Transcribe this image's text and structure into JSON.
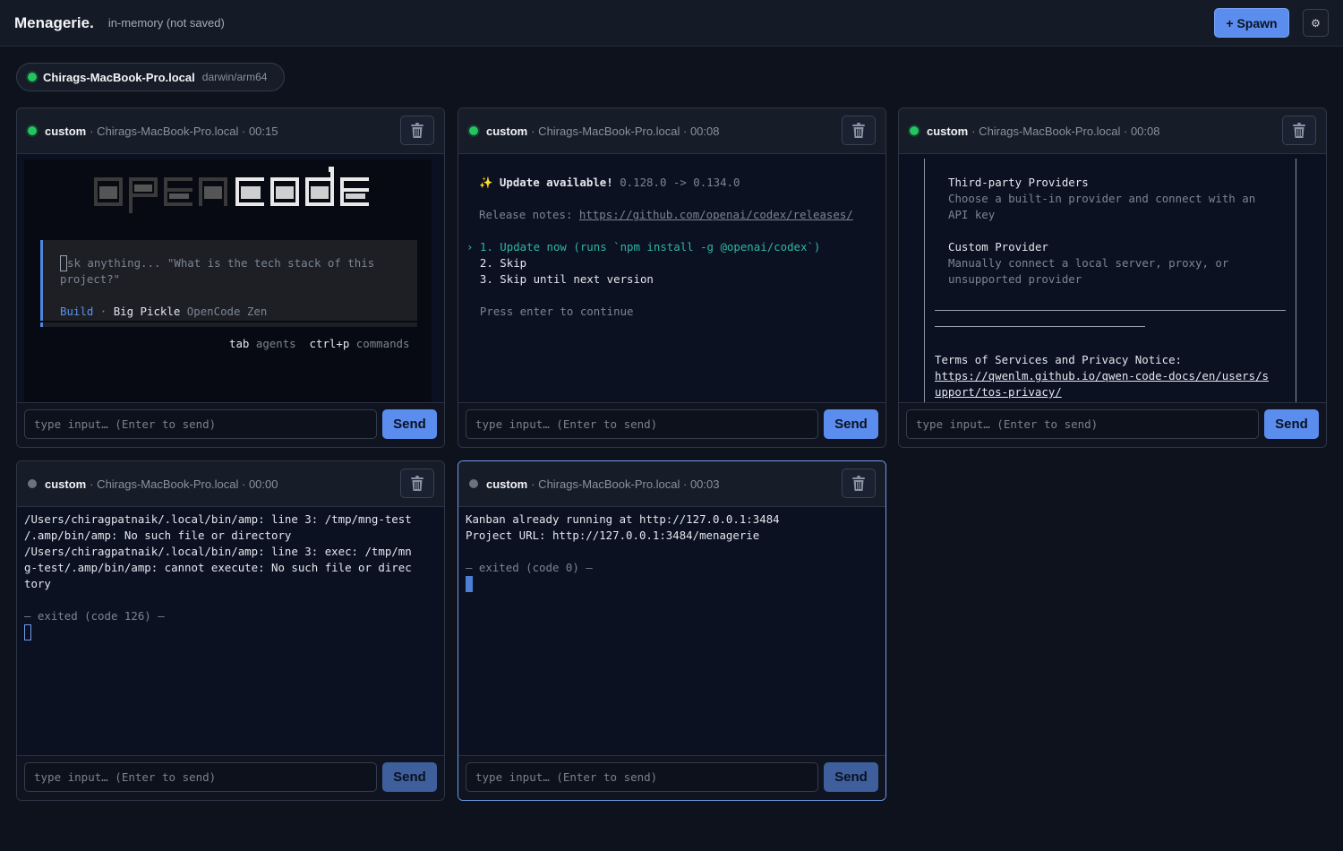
{
  "app": {
    "title": "Menagerie.",
    "subtitle": "in-memory (not saved)",
    "spawn_label": "+ Spawn",
    "settings_glyph": "⚙"
  },
  "host": {
    "name": "Chirags-MacBook-Pro.local",
    "arch": "darwin/arm64",
    "status": "online"
  },
  "input_placeholder": "type input… (Enter to send)",
  "send_label": "Send",
  "panels": [
    {
      "kind": "custom",
      "meta": "· Chirags-MacBook-Pro.local · 00:15",
      "status": "running",
      "term": {
        "prompt_placeholder_1": "sk anything... \"What is the tech stack of this",
        "prompt_placeholder_2": "project?\"",
        "agent": "Build",
        "model": "Big Pickle",
        "provider": "OpenCode Zen",
        "hint_key_1": "tab",
        "hint_label_1": "agents",
        "hint_key_2": "ctrl+p",
        "hint_label_2": "commands"
      }
    },
    {
      "kind": "custom",
      "meta": "· Chirags-MacBook-Pro.local · 00:08",
      "status": "running",
      "term": {
        "update_icon": "✨",
        "update_title": "Update available!",
        "update_versions": "0.128.0 -> 0.134.0",
        "notes_label": "Release notes: ",
        "notes_url": "https://github.com/openai/codex/releases/",
        "option_1": "› 1. Update now (runs `npm install -g @openai/codex`)",
        "option_2": "  2. Skip",
        "option_3": "  3. Skip until next version",
        "press_enter": "  Press enter to continue"
      }
    },
    {
      "kind": "custom",
      "meta": "· Chirags-MacBook-Pro.local · 00:08",
      "status": "running",
      "term": {
        "tp_title": "Third-party Providers",
        "tp_desc_1": "Choose a built-in provider and connect with an",
        "tp_desc_2": "API key",
        "cp_title": "Custom Provider",
        "cp_desc_1": "Manually connect a local server, proxy, or",
        "cp_desc_2": "unsupported provider",
        "tos_label": "Terms of Services and Privacy Notice:",
        "tos_url_1": "https://qwenlm.github.io/qwen-code-docs/en/users/s",
        "tos_url_2": "upport/tos-privacy/"
      }
    },
    {
      "kind": "custom",
      "meta": "· Chirags-MacBook-Pro.local · 00:00",
      "status": "exited",
      "term": {
        "line_1": "/Users/chiragpatnaik/.local/bin/amp: line 3: /tmp/mng-test",
        "line_2": "/.amp/bin/amp: No such file or directory",
        "line_3": "/Users/chiragpatnaik/.local/bin/amp: line 3: exec: /tmp/mn",
        "line_4": "g-test/.amp/bin/amp: cannot execute: No such file or direc",
        "line_5": "tory",
        "exit": "— exited (code 126) —"
      }
    },
    {
      "kind": "custom",
      "meta": "· Chirags-MacBook-Pro.local · 00:03",
      "status": "exited",
      "term": {
        "line_1": "Kanban already running at http://127.0.0.1:3484",
        "line_2": "Project URL: http://127.0.0.1:3484/menagerie",
        "exit": "— exited (code 0) —"
      }
    }
  ]
}
